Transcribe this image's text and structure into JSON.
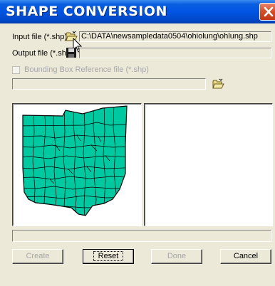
{
  "window": {
    "title": "SHAPE CONVERSION"
  },
  "inputs": {
    "input_file_label": "Input file (*.shp)",
    "input_file_value": "C:\\DATA\\newsampledata0504\\ohiolung\\ohlung.shp",
    "output_file_label": "Output file (*.shp)",
    "output_file_value": "",
    "bbox_label": "Bounding Box Reference  file (*.shp)",
    "bbox_checked": false,
    "bbox_value": ""
  },
  "icons": {
    "open_folder": "open-folder-icon",
    "save_disk": "floppy-disk-icon",
    "close": "close-icon"
  },
  "colors": {
    "map_fill": "#00c8a0",
    "title_bar": "#0054e3",
    "close_button": "#d8502a"
  },
  "buttons": {
    "create": "Create",
    "reset": "Reset",
    "done": "Done",
    "cancel": "Cancel"
  }
}
